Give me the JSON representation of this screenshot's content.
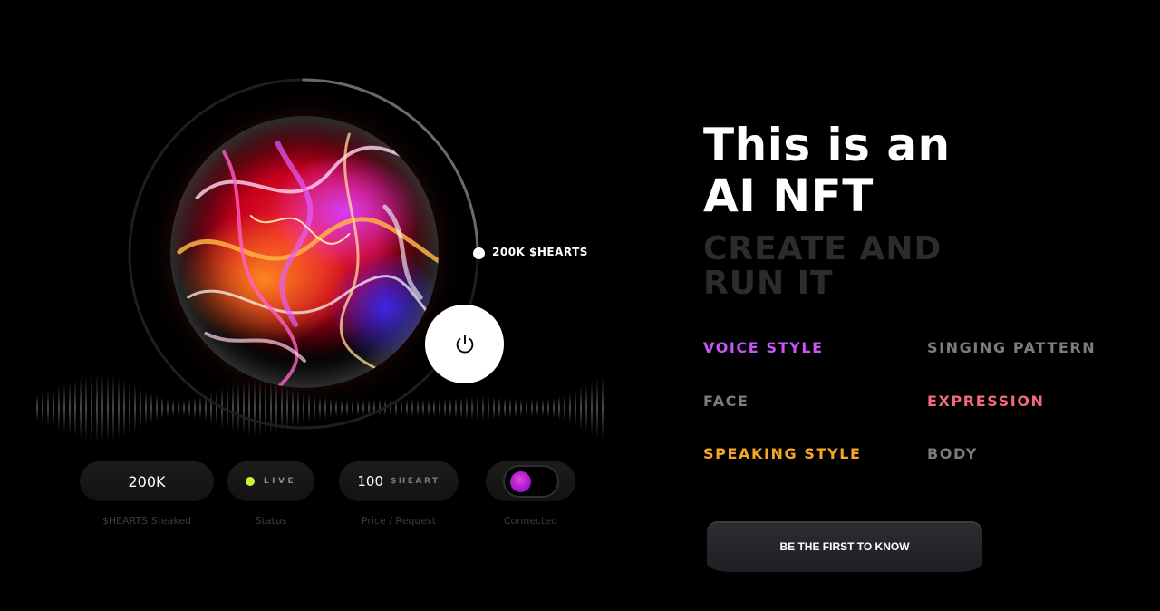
{
  "hero": {
    "staked_indicator_label": "200K $HEARTS"
  },
  "stats": {
    "staked": {
      "value": "200K",
      "label": "$HEARTS Steaked"
    },
    "status": {
      "value": "LIVE",
      "label": "Status",
      "color": "#c6f432"
    },
    "price": {
      "value": "100",
      "unit": "$HEART",
      "label": "Price / Request"
    },
    "connected": {
      "label": "Connected",
      "on": true
    }
  },
  "headline": {
    "line1": "This is an",
    "line2": "AI NFT"
  },
  "subheadline": {
    "line1": "CREATE AND",
    "line2": "RUN IT"
  },
  "features": [
    {
      "label": "VOICE STYLE",
      "color": "#c658f5"
    },
    {
      "label": "SINGING PATTERN",
      "color": "#7c7c7c"
    },
    {
      "label": "FACE",
      "color": "#7c7c7c"
    },
    {
      "label": "EXPRESSION",
      "color": "#f3697f"
    },
    {
      "label": "SPEAKING STYLE",
      "color": "#f7a62a"
    },
    {
      "label": "BODY",
      "color": "#7c7c7c"
    }
  ],
  "cta": {
    "label": "BE THE FIRST TO KNOW"
  },
  "icons": {
    "power_button": "power-icon",
    "orb": "fluid-orb-artwork"
  }
}
